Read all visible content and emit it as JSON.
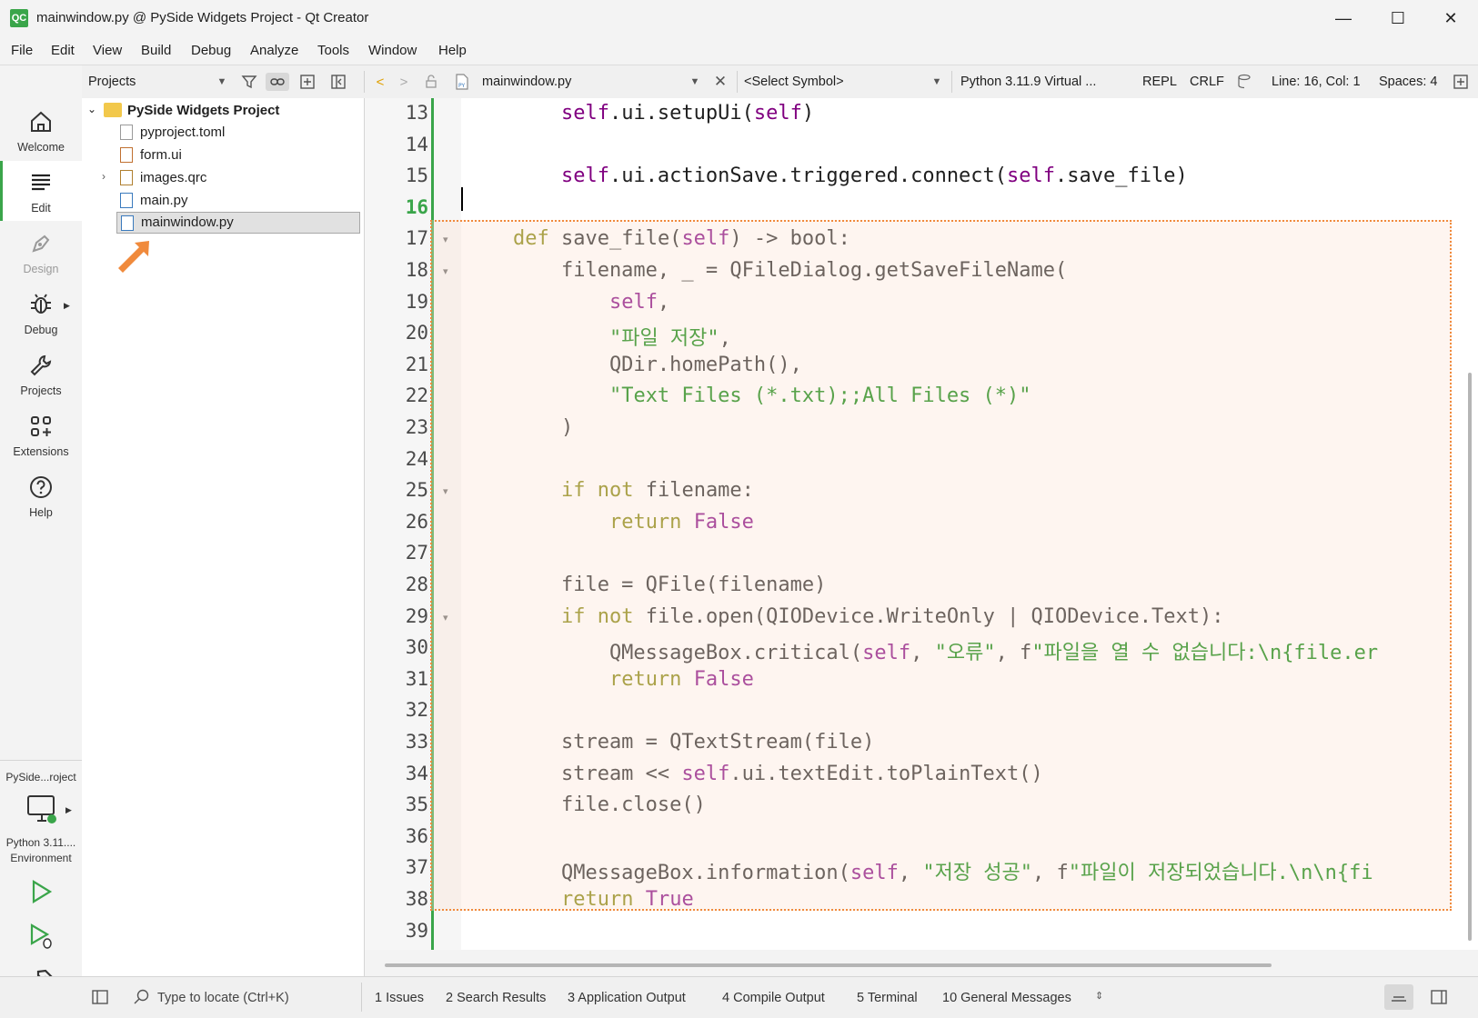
{
  "window": {
    "title": "mainwindow.py @ PySide Widgets Project - Qt Creator",
    "app_icon_text": "QC",
    "minimize": "—",
    "maximize": "☐",
    "close": "✕"
  },
  "menu": [
    "File",
    "Edit",
    "View",
    "Build",
    "Debug",
    "Analyze",
    "Tools",
    "Window",
    "Help"
  ],
  "toolbar": {
    "projects_combo": "Projects",
    "file_tab": "mainwindow.py",
    "symbol_combo": "<Select Symbol>",
    "python_env": "Python 3.11.9 Virtual ...",
    "repl": "REPL",
    "line_ending": "CRLF",
    "cursor_pos": "Line: 16, Col: 1",
    "indent": "Spaces: 4"
  },
  "modes": [
    {
      "label": "Welcome",
      "icon": "home-icon"
    },
    {
      "label": "Edit",
      "icon": "edit-icon"
    },
    {
      "label": "Design",
      "icon": "design-icon"
    },
    {
      "label": "Debug",
      "icon": "bug-icon"
    },
    {
      "label": "Projects",
      "icon": "wrench-icon"
    },
    {
      "label": "Extensions",
      "icon": "extensions-icon"
    },
    {
      "label": "Help",
      "icon": "help-icon"
    }
  ],
  "kit": {
    "project_short": "PySide...roject",
    "env_line1": "Python 3.11....",
    "env_line2": "Environment"
  },
  "project_tree": {
    "root": "PySide Widgets Project",
    "items": [
      "pyproject.toml",
      "form.ui",
      "images.qrc",
      "main.py",
      "mainwindow.py"
    ]
  },
  "editor": {
    "current_line": 16,
    "lines": [
      {
        "n": "13",
        "html": "        <span class=\"sf\">self</span>.ui.setupUi(<span class=\"sf\">self</span>)"
      },
      {
        "n": "14",
        "html": ""
      },
      {
        "n": "15",
        "html": "        <span class=\"sf\">self</span>.ui.actionSave.triggered.connect(<span class=\"sf\">self</span>.save_file)"
      },
      {
        "n": "16",
        "html": ""
      },
      {
        "n": "17",
        "html": "    <span class=\"kw\">def</span> save_file(<span class=\"sf\">self</span>) -&gt; bool:"
      },
      {
        "n": "18",
        "html": "        filename, _ = QFileDialog.getSaveFileName("
      },
      {
        "n": "19",
        "html": "            <span class=\"sf\">self</span>,"
      },
      {
        "n": "20",
        "html": "            <span class=\"str\">\"파일 저장\"</span>,"
      },
      {
        "n": "21",
        "html": "            QDir.homePath(),"
      },
      {
        "n": "22",
        "html": "            <span class=\"str\">\"Text Files (*.txt);;All Files (*)\"</span>"
      },
      {
        "n": "23",
        "html": "        )"
      },
      {
        "n": "24",
        "html": ""
      },
      {
        "n": "25",
        "html": "        <span class=\"kw\">if</span> <span class=\"kw\">not</span> filename:"
      },
      {
        "n": "26",
        "html": "            <span class=\"kw\">return</span> <span class=\"tr\">False</span>"
      },
      {
        "n": "27",
        "html": ""
      },
      {
        "n": "28",
        "html": "        file = QFile(filename)"
      },
      {
        "n": "29",
        "html": "        <span class=\"kw\">if</span> <span class=\"kw\">not</span> file.open(QIODevice.WriteOnly | QIODevice.Text):"
      },
      {
        "n": "30",
        "html": "            QMessageBox.critical(<span class=\"sf\">self</span>, <span class=\"str\">\"오류\"</span>, f<span class=\"str\">\"파일을 열 수 없습니다:\\n{file.er</span>"
      },
      {
        "n": "31",
        "html": "            <span class=\"kw\">return</span> <span class=\"tr\">False</span>"
      },
      {
        "n": "32",
        "html": ""
      },
      {
        "n": "33",
        "html": "        stream = QTextStream(file)"
      },
      {
        "n": "34",
        "html": "        stream &lt;&lt; <span class=\"sf\">self</span>.ui.textEdit.toPlainText()"
      },
      {
        "n": "35",
        "html": "        file.close()"
      },
      {
        "n": "36",
        "html": ""
      },
      {
        "n": "37",
        "html": "        QMessageBox.information(<span class=\"sf\">self</span>, <span class=\"str\">\"저장 성공\"</span>, f<span class=\"str\">\"파일이 저장되었습니다.\\n\\n{fi</span>"
      },
      {
        "n": "38",
        "html": "        <span class=\"kw\">return</span> <span class=\"tr\">True</span>"
      },
      {
        "n": "39",
        "html": ""
      }
    ]
  },
  "status": {
    "locate_placeholder": "Type to locate (Ctrl+K)",
    "panes": [
      "1  Issues",
      "2  Search Results",
      "3  Application Output",
      "4  Compile Output",
      "5  Terminal",
      "10  General Messages"
    ]
  },
  "colors": {
    "accent_green": "#3aa54a",
    "highlight_border": "#f08a3c",
    "arrow": "#f08a3c"
  }
}
